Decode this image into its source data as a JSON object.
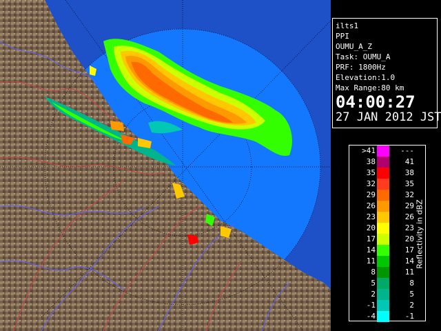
{
  "info": {
    "station": "ilts1",
    "product": "PPI",
    "product_id": "OUMU_A_Z",
    "task": "Task: OUMU_A",
    "prf": "PRF: 1800Hz",
    "elevation": "Elevation:1.0",
    "max_range": "Max Range:80 km",
    "time": "04:00:27",
    "date": "27 JAN 2012 JST"
  },
  "legend": {
    "unit_label": "Reflectivity in dBZ",
    "rows": [
      {
        "lo": ">41",
        "hi": "---",
        "color": "#ff00ff"
      },
      {
        "lo": "38",
        "hi": "41",
        "color": "#b0006e"
      },
      {
        "lo": "35",
        "hi": "38",
        "color": "#ff0000"
      },
      {
        "lo": "32",
        "hi": "35",
        "color": "#ff3c1e"
      },
      {
        "lo": "29",
        "hi": "32",
        "color": "#ff6a00"
      },
      {
        "lo": "26",
        "hi": "29",
        "color": "#ff9900"
      },
      {
        "lo": "23",
        "hi": "26",
        "color": "#ffc800"
      },
      {
        "lo": "20",
        "hi": "23",
        "color": "#ffff00"
      },
      {
        "lo": "17",
        "hi": "20",
        "color": "#ccff00"
      },
      {
        "lo": "14",
        "hi": "17",
        "color": "#33ff00"
      },
      {
        "lo": "11",
        "hi": "14",
        "color": "#00c800"
      },
      {
        "lo": "8",
        "hi": "11",
        "color": "#009600"
      },
      {
        "lo": "5",
        "hi": "8",
        "color": "#00aa66"
      },
      {
        "lo": "2",
        "hi": "5",
        "color": "#00b48c"
      },
      {
        "lo": "-1",
        "hi": "2",
        "color": "#00c8b4"
      },
      {
        "lo": "-4",
        "hi": "-1",
        "color": "#00ffff"
      }
    ]
  },
  "colors": {
    "sea_inner": "#1478ff",
    "sea_outer": "#1e50c8",
    "land": "#7a6450",
    "range_ring": "#000000"
  }
}
